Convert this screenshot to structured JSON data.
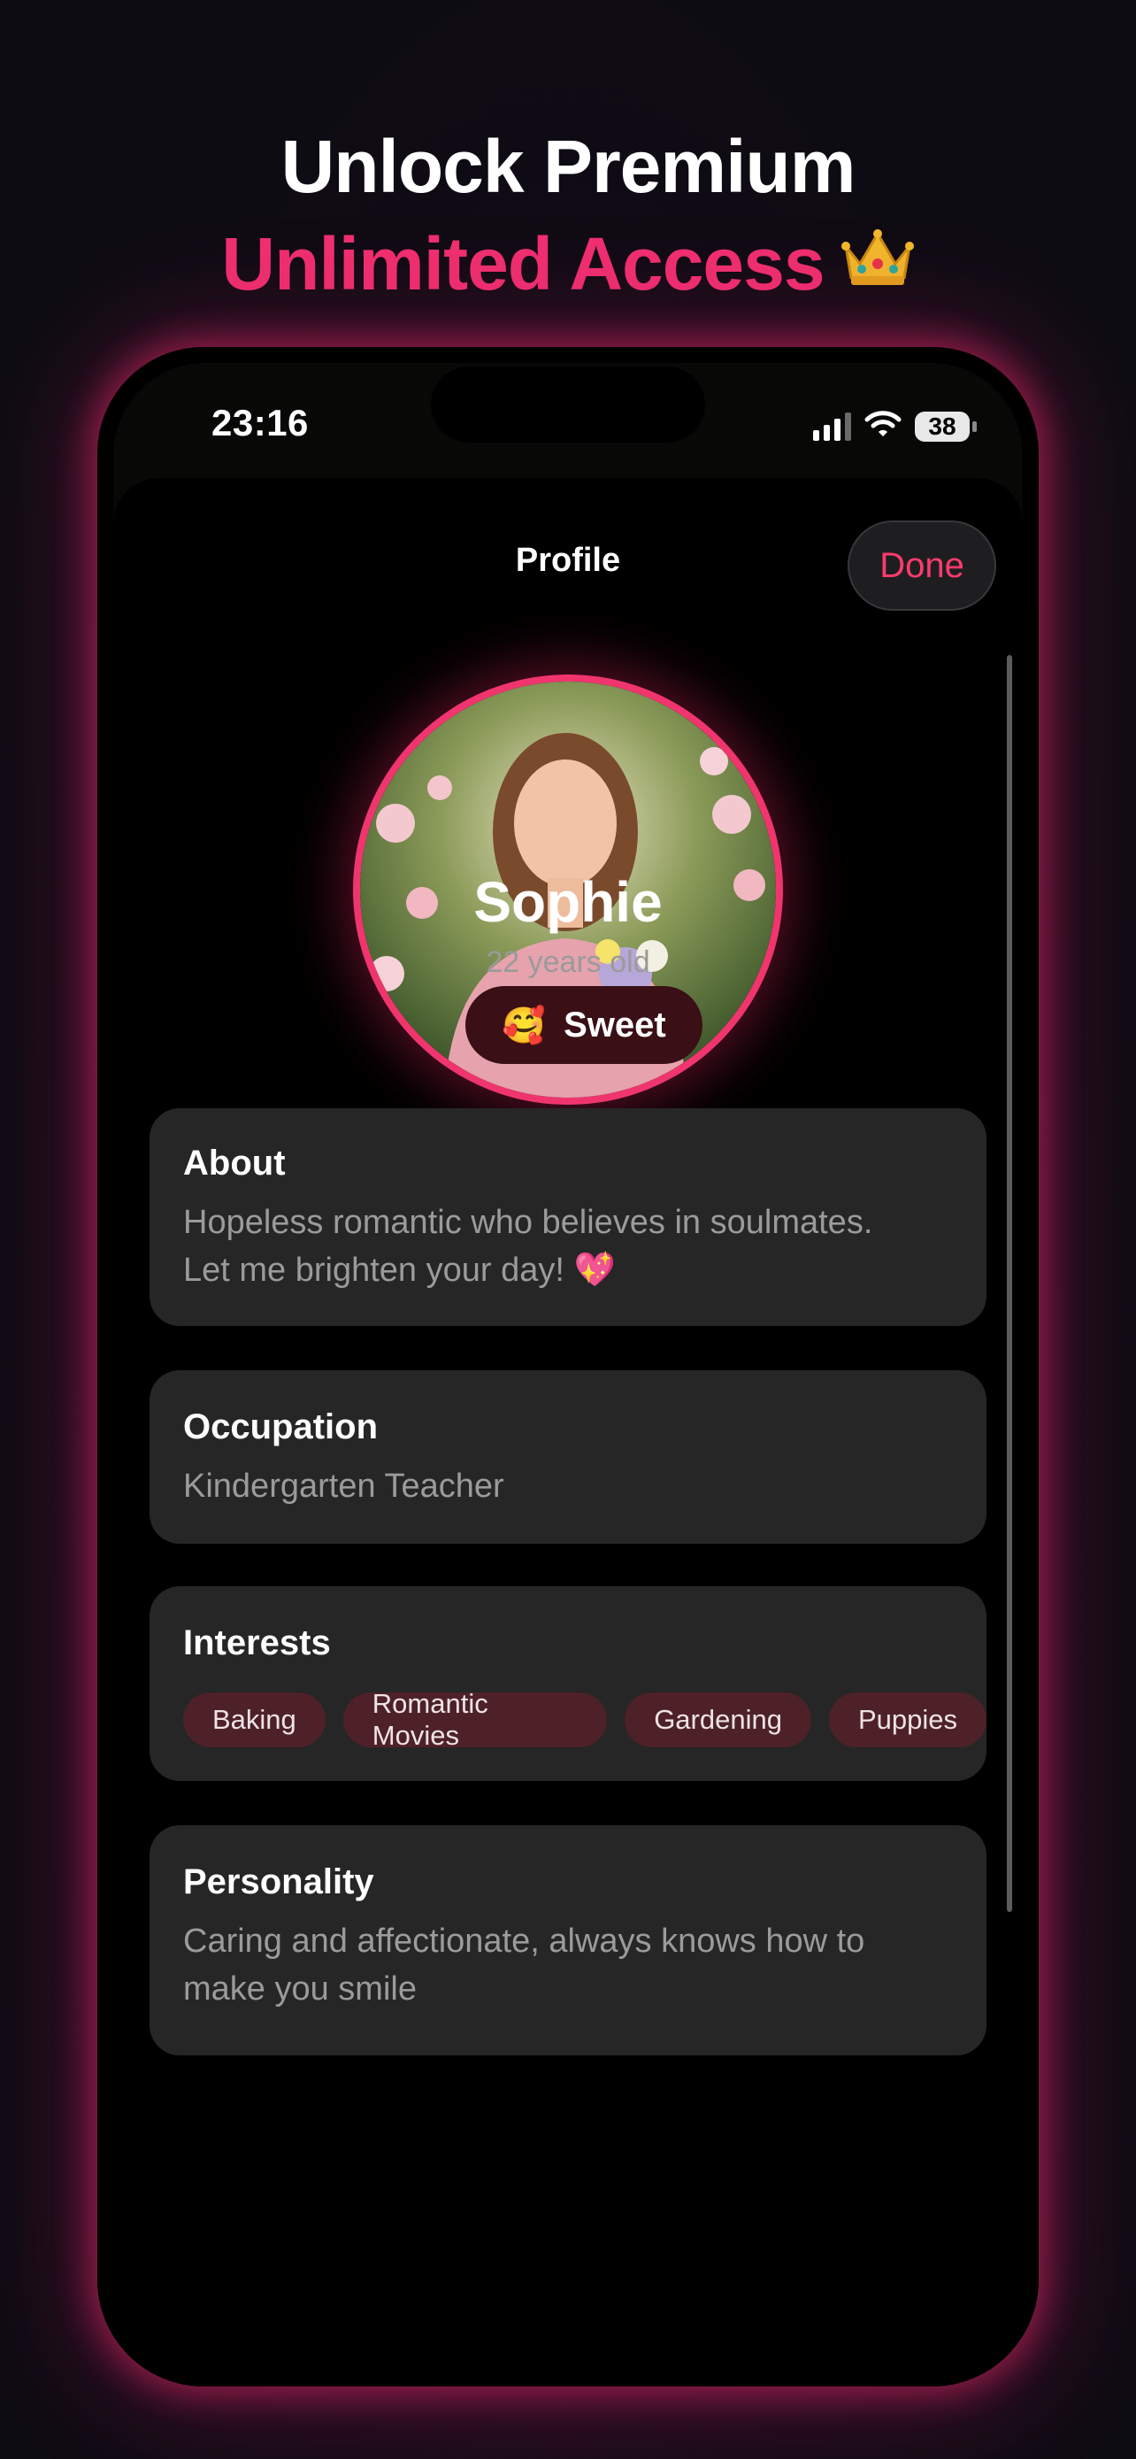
{
  "promo": {
    "line1": "Unlock Premium",
    "line2": "Unlimited Access",
    "crown_icon": "crown-icon",
    "accent_color": "#ef2f6f"
  },
  "status_bar": {
    "time": "23:16",
    "battery": "38"
  },
  "header": {
    "title": "Profile",
    "done_label": "Done"
  },
  "profile": {
    "name": "Sophie",
    "age": "22 years old",
    "mood_emoji": "🥰",
    "mood_label": "Sweet",
    "sections": {
      "about": {
        "title": "About",
        "line1": "Hopeless romantic who believes in soulmates.",
        "line2": "Let me brighten your day! 💖"
      },
      "occupation": {
        "title": "Occupation",
        "text": "Kindergarten Teacher"
      },
      "interests": {
        "title": "Interests",
        "tags": [
          "Baking",
          "Romantic Movies",
          "Gardening",
          "Puppies"
        ]
      },
      "personality": {
        "title": "Personality",
        "line1": "Caring and affectionate, always knows how to",
        "line2": "make you smile"
      }
    }
  }
}
